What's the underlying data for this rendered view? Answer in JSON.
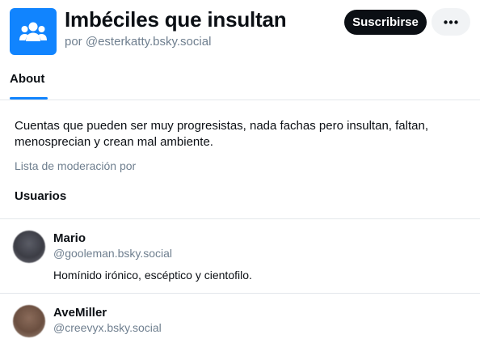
{
  "header": {
    "title": "Imbéciles que insultan",
    "byline_prefix": "por",
    "byline_handle": "@esterkatty.bsky.social",
    "subscribe_label": "Suscribirse",
    "more_icon": "ellipsis-icon",
    "avatar_icon": "users-group-icon",
    "accent_color": "#1184fe"
  },
  "tabs": [
    {
      "label": "About",
      "active": true
    }
  ],
  "about": {
    "description": "Cuentas que pueden ser muy progresistas, nada fachas pero insultan, faltan, menosprecian y crean mal ambiente.",
    "moderation_label": "Lista de moderación por",
    "members_heading": "Usuarios"
  },
  "members": [
    {
      "name": "Mario",
      "handle": "@gooleman.bsky.social",
      "bio": "Homínido irónico, escéptico y cientofilo."
    },
    {
      "name": "AveMiller",
      "handle": "@creevyx.bsky.social",
      "bio": ""
    }
  ]
}
